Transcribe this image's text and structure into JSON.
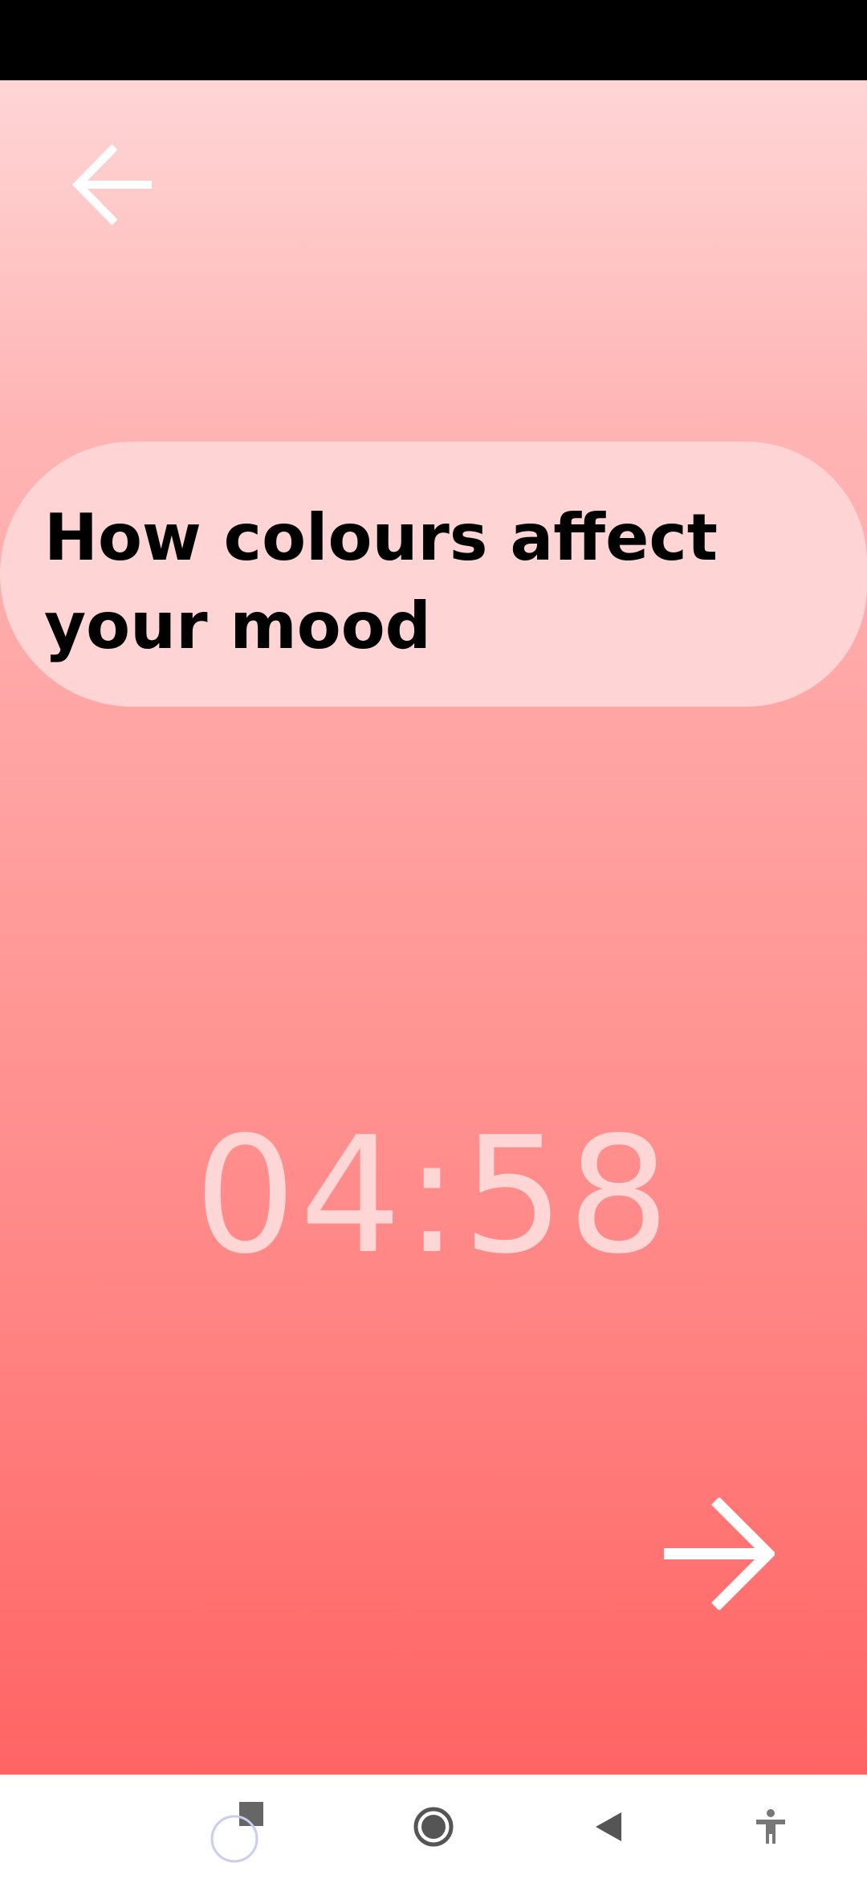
{
  "title": "How colours affect your mood",
  "timer": "04:58",
  "icons": {
    "back": "arrow-left-icon",
    "next": "arrow-right-icon",
    "recents": "recents-square-icon",
    "home": "home-circle-icon",
    "system_back": "back-triangle-icon",
    "accessibility": "accessibility-icon"
  },
  "colors": {
    "gradient_top": "#FFD5D5",
    "gradient_bottom": "#FF6463",
    "card": "#FFD4D4",
    "timer_text": "#FFD6D6",
    "title_text": "#000000"
  }
}
